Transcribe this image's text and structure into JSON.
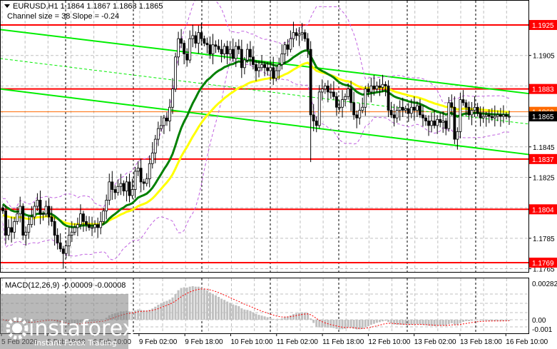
{
  "header": {
    "symbol_line": "EURUSD,H1  1.1864 1.1867 1.1863 1.1865",
    "indicator_line": "Channel size = 38 Slope = -0.24"
  },
  "macd": {
    "label": "MACD(12,26,9) -0.00009 -0.00008",
    "axis_labels": [
      "0.00282",
      "0.00",
      "-0.001"
    ],
    "axis_values": [
      0.00282,
      0.0,
      -0.001
    ]
  },
  "logo": {
    "name": "instaforex",
    "tagline": "Instant Forex Trading"
  },
  "colors": {
    "level": "#ff0000",
    "channel": "#00ee00",
    "ma_fast": "#008000",
    "ma_slow": "#ffff00",
    "bands": "#c060e0",
    "ask": "#ff6a00",
    "bid": "#000000",
    "macd_hist": "#c0c0c0",
    "macd_signal": "#ff0000"
  },
  "chart_data": {
    "type": "candlestick",
    "symbol": "EURUSD",
    "timeframe": "H1",
    "ylim": [
      1.176,
      1.1942
    ],
    "price_ticks": [
      "1.1905",
      "1.1845",
      "1.1825",
      "1.1785",
      "1.1765"
    ],
    "price_tick_values": [
      1.1905,
      1.1845,
      1.1825,
      1.1785,
      1.1765
    ],
    "grid_values": [
      1.1925,
      1.1905,
      1.1885,
      1.1865,
      1.1845,
      1.1825,
      1.1805,
      1.1785,
      1.1765
    ],
    "levels": [
      {
        "label": "1.1925",
        "value": 1.1925
      },
      {
        "label": "1.1883",
        "value": 1.1883
      },
      {
        "label": "1.1837",
        "value": 1.1837
      },
      {
        "label": "1.1804",
        "value": 1.1804
      },
      {
        "label": "1.1769",
        "value": 1.1769
      }
    ],
    "ask": {
      "label": "1.1868",
      "value": 1.1868
    },
    "bid": {
      "label": "1.1865",
      "value": 1.1865
    },
    "channel": {
      "upper": [
        1.1922,
        1.188
      ],
      "middle": [
        1.1903,
        1.186
      ],
      "lower": [
        1.1883,
        1.184
      ]
    },
    "x_labels": [
      "5 Feb 2026",
      "5 Feb 18:00",
      "6 Feb 10:00",
      "9 Feb 02:00",
      "9 Feb 18:00",
      "10 Feb 10:00",
      "11 Feb 02:00",
      "11 Feb 18:00",
      "12 Feb 10:00",
      "13 Feb 02:00",
      "13 Feb 18:00",
      "16 Feb 10:00"
    ],
    "spike_lows": [
      {
        "index": 107,
        "low": 1.1835
      },
      {
        "index": 21,
        "low": 1.1765
      }
    ],
    "closes": [
      1.1803,
      1.1787,
      1.1792,
      1.1789,
      1.1796,
      1.1801,
      1.1806,
      1.1787,
      1.1789,
      1.1794,
      1.1799,
      1.1806,
      1.181,
      1.1801,
      1.1801,
      1.1806,
      1.1799,
      1.1796,
      1.1787,
      1.1782,
      1.1778,
      1.1775,
      1.178,
      1.1787,
      1.1789,
      1.1792,
      1.1794,
      1.1801,
      1.1796,
      1.1794,
      1.1792,
      1.1792,
      1.1794,
      1.1792,
      1.1796,
      1.1803,
      1.181,
      1.1822,
      1.1817,
      1.1815,
      1.1819,
      1.1821,
      1.1816,
      1.1822,
      1.1813,
      1.1817,
      1.1829,
      1.1831,
      1.1822,
      1.1821,
      1.1824,
      1.1834,
      1.1841,
      1.185,
      1.1857,
      1.1859,
      1.1864,
      1.1862,
      1.1871,
      1.1883,
      1.1904,
      1.1916,
      1.1913,
      1.1906,
      1.1902,
      1.1916,
      1.1918,
      1.1913,
      1.192,
      1.1916,
      1.1913,
      1.1912,
      1.1906,
      1.1912,
      1.1911,
      1.1909,
      1.1906,
      1.1911,
      1.1906,
      1.1909,
      1.1903,
      1.1911,
      1.1909,
      1.1897,
      1.1902,
      1.1909,
      1.1904,
      1.1899,
      1.1895,
      1.1897,
      1.1899,
      1.1897,
      1.1895,
      1.1897,
      1.189,
      1.1895,
      1.1899,
      1.1906,
      1.1912,
      1.1909,
      1.1916,
      1.192,
      1.1918,
      1.1919,
      1.192,
      1.1916,
      1.1909,
      1.1866,
      1.1862,
      1.1859,
      1.1881,
      1.1883,
      1.1885,
      1.1881,
      1.1881,
      1.1878,
      1.1871,
      1.1871,
      1.1876,
      1.1878,
      1.1883,
      1.1874,
      1.1866,
      1.1864,
      1.1869,
      1.1871,
      1.1883,
      1.1881,
      1.1885,
      1.1883,
      1.1885,
      1.1884,
      1.1886,
      1.1885,
      1.1869,
      1.1866,
      1.1864,
      1.1869,
      1.1871,
      1.1869,
      1.187,
      1.1867,
      1.1871,
      1.1869,
      1.1872,
      1.1866,
      1.1864,
      1.1862,
      1.1859,
      1.1862,
      1.1859,
      1.1863,
      1.1861,
      1.1862,
      1.1857,
      1.1874,
      1.1871,
      1.185,
      1.1855,
      1.1876,
      1.1874,
      1.1871,
      1.1866,
      1.1869,
      1.1871,
      1.1867,
      1.1864,
      1.1865,
      1.1866,
      1.1865,
      1.1864,
      1.1865,
      1.1866,
      1.1865,
      1.1866,
      1.1865,
      1.1865
    ]
  }
}
